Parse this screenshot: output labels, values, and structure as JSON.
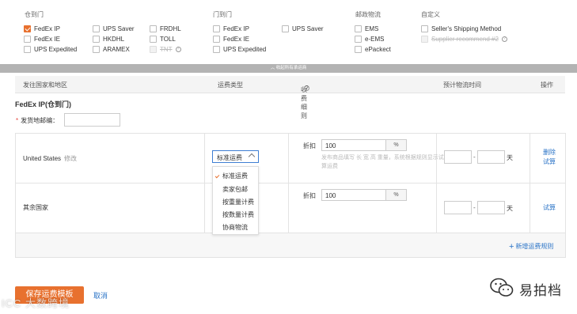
{
  "groups": [
    {
      "title": "仓到门",
      "x": 0
    },
    {
      "title": "门到门",
      "x": 0
    },
    {
      "title": "邮政物流",
      "x": 0
    },
    {
      "title": "自定义",
      "x": 0
    }
  ],
  "carriers": {
    "warehouse_to_door": [
      "FedEx IP",
      "FedEx IE",
      "UPS Expedited",
      "UPS Saver",
      "HKDHL",
      "ARAMEX",
      "FRDHL",
      "TOLL",
      "TNT"
    ],
    "door_to_door": [
      "FedEx IP",
      "FedEx IE",
      "UPS Expedited",
      "UPS Saver"
    ],
    "postal": [
      "EMS",
      "e-EMS",
      "ePackect"
    ],
    "custom": [
      "Seller's Shipping Method",
      "Supplier recommend #2"
    ]
  },
  "collapse_label": "收起所有承运商",
  "table_headers": {
    "destination": "发往国家和地区",
    "fee_type": "运费类型",
    "fee_detail": "收费细则",
    "delivery_time": "预计物流时间",
    "action": "操作"
  },
  "section_title": "FedEx IP(仓到门)",
  "zip_label": "发货地邮编：",
  "zip_required": "*",
  "rows": [
    {
      "country": "United States",
      "edit": "修改",
      "discount_label": "折扣",
      "discount": "100",
      "unit": "%",
      "hint": "发布商品填写 长 宽 高 重量，系统根据规则显示试算运费",
      "day": "天",
      "dash": "-",
      "op1": "删除",
      "op2": "试算"
    },
    {
      "country": "其余国家",
      "discount_label": "折扣",
      "discount": "100",
      "unit": "%",
      "day": "天",
      "dash": "-",
      "op1": "试算"
    }
  ],
  "fee_type_select": {
    "value": "标准运费",
    "options": [
      "标准运费",
      "卖家包邮",
      "按重量计费",
      "按数量计费",
      "协商物流"
    ]
  },
  "add_rule": "新增运费规则",
  "save_button": "保存运费模板",
  "cancel": "取消",
  "watermark_left": "ICC 大数跨境",
  "watermark_right": "易拍档",
  "colors": {
    "accent": "#e8712f",
    "link": "#2b74c7",
    "collapse_bar": "#b3b3b3"
  }
}
